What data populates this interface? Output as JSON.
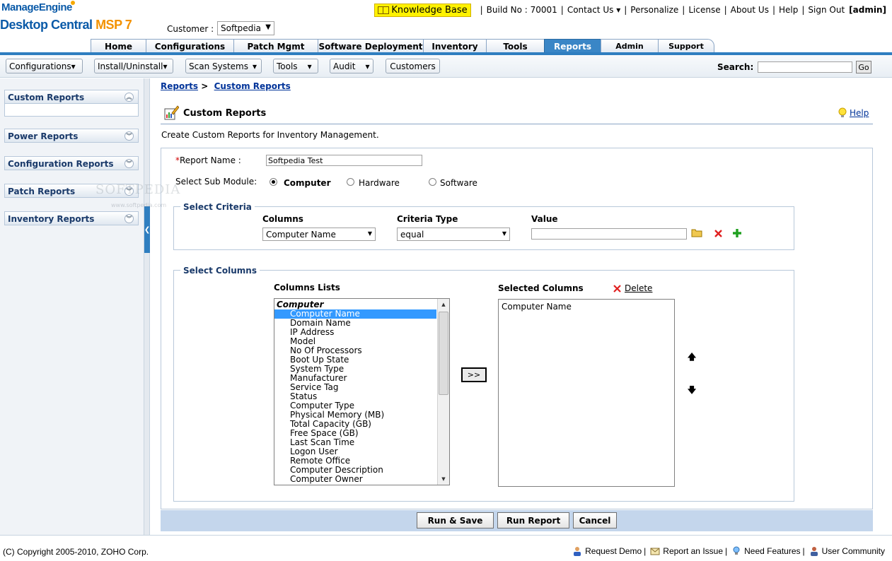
{
  "brand": {
    "line1": "ManageEngine",
    "line2": "Desktop Central",
    "line2_suffix": "MSP 7"
  },
  "customer": {
    "label": "Customer :",
    "value": "Softpedia"
  },
  "topnav": {
    "knowledge_base": "Knowledge Base",
    "build": "Build No : 70001",
    "contact": "Contact Us",
    "personalize": "Personalize",
    "license": "License",
    "about": "About Us",
    "help": "Help",
    "signout": "Sign Out",
    "user": "[admin]"
  },
  "tabs": [
    "Home",
    "Configurations",
    "Patch Mgmt",
    "Software Deployment",
    "Inventory",
    "Tools",
    "Reports",
    "Admin",
    "Support"
  ],
  "active_tab": "Reports",
  "subbar": {
    "configurations": "Configurations",
    "install": "Install/Uninstall",
    "scan": "Scan Systems",
    "tools": "Tools",
    "audit": "Audit",
    "customers": "Customers",
    "search_label": "Search:",
    "go": "Go"
  },
  "sidebar": {
    "sections": [
      "Custom Reports",
      "Power Reports",
      "Configuration Reports",
      "Patch Reports",
      "Inventory Reports"
    ]
  },
  "breadcrumb": {
    "root": "Reports",
    "sep": ">",
    "current": "Custom Reports"
  },
  "page": {
    "title": "Custom Reports",
    "help": "Help",
    "description": "Create Custom Reports for Inventory Management."
  },
  "form": {
    "report_name_label": "Report Name :",
    "report_name_value": "Softpedia Test",
    "sub_module_label": "Select Sub Module:",
    "sub_modules": [
      "Computer",
      "Hardware",
      "Software"
    ],
    "selected_sub_module": "Computer",
    "criteria_legend": "Select Criteria",
    "criteria": {
      "columns_head": "Columns",
      "type_head": "Criteria Type",
      "value_head": "Value",
      "column_value": "Computer Name",
      "type_value": "equal",
      "value_value": ""
    },
    "columns_legend": "Select Columns",
    "columns_list_head": "Columns Lists",
    "selected_head": "Selected Columns",
    "delete": "Delete",
    "group": "Computer",
    "options": [
      "Computer Name",
      "Domain Name",
      "IP Address",
      "Model",
      "No Of Processors",
      "Boot Up State",
      "System Type",
      "Manufacturer",
      "Service Tag",
      "Status",
      "Computer Type",
      "Physical Memory (MB)",
      "Total Capacity (GB)",
      "Free Space (GB)",
      "Last Scan Time",
      "Logon User",
      "Remote Office",
      "Computer Description",
      "Computer Owner"
    ],
    "highlighted_option": "Computer Name",
    "selected_columns": [
      "Computer Name"
    ],
    "move_button": ">>"
  },
  "actions": {
    "run_save": "Run & Save",
    "run_report": "Run Report",
    "cancel": "Cancel"
  },
  "footer": {
    "copyright": "(C) Copyright 2005-2010, ZOHO Corp.",
    "request_demo": "Request Demo",
    "report_issue": "Report an Issue",
    "need_features": "Need Features",
    "user_community": "User Community"
  },
  "watermark": {
    "main": "SOFTPEDIA",
    "sub": "www.softpedia.com"
  },
  "colors": {
    "accent": "#2f7ec0",
    "brand": "#0a5aa8",
    "brand_suffix": "#f39200",
    "kb": "#fff200"
  }
}
